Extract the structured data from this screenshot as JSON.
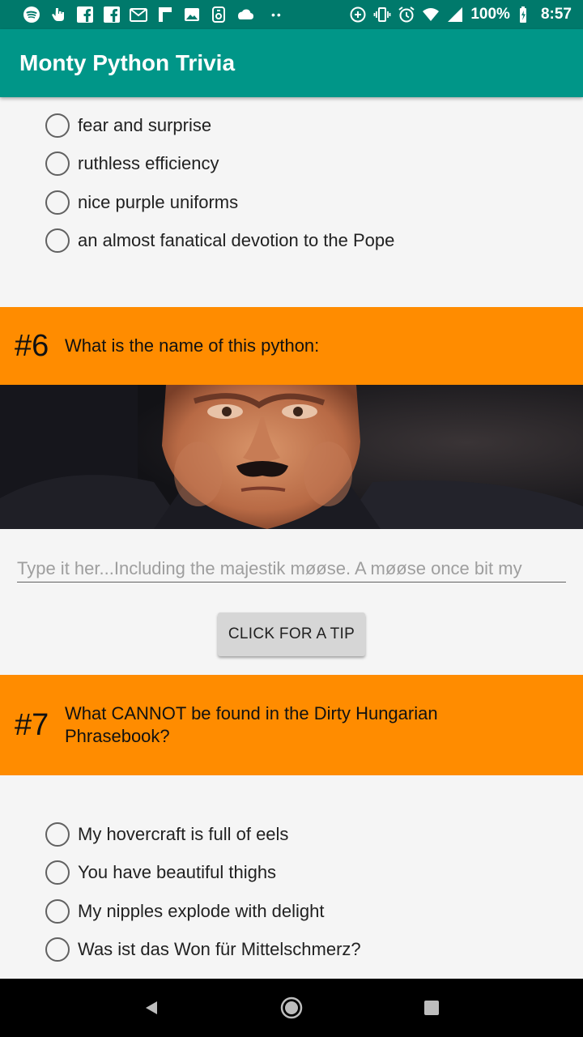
{
  "status_bar": {
    "battery": "100%",
    "time": "8:57"
  },
  "app_bar": {
    "title": "Monty Python Trivia"
  },
  "question5": {
    "options": [
      "fear and surprise",
      "ruthless efficiency",
      "nice purple uniforms",
      "an almost fanatical devotion to the Pope"
    ]
  },
  "question6": {
    "number": "#6",
    "text": "What is the name of this python:",
    "answer_placeholder": "Type it her...Including the majestik møøse. A møøse once bit my",
    "tip_button": "CLICK FOR A TIP"
  },
  "question7": {
    "number": "#7",
    "text": "What CANNOT be found in the Dirty Hungarian Phrasebook?",
    "options": [
      "My hovercraft is full of eels",
      "You have beautiful thighs",
      "My nipples explode with delight",
      "Was ist das Won für Mittelschmerz?"
    ]
  },
  "colors": {
    "status_bar": "#00796b",
    "app_bar": "#009688",
    "question_header": "#ff8c00"
  },
  "icons": {
    "status_left": [
      "spotify-icon",
      "hand-icon",
      "facebook-icon",
      "facebook-icon",
      "gmail-icon",
      "flipboard-icon",
      "image-icon",
      "lock-icon",
      "cloud-icon"
    ],
    "status_right": [
      "data-saver-icon",
      "vibrate-icon",
      "alarm-icon",
      "wifi-icon",
      "signal-icon",
      "battery-icon"
    ],
    "nav": [
      "back-icon",
      "home-icon",
      "recents-icon"
    ]
  }
}
